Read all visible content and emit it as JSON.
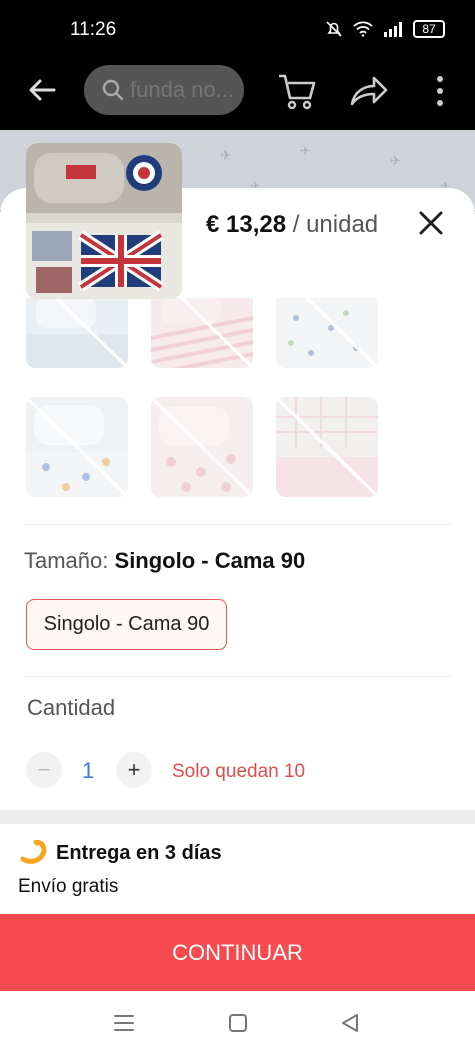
{
  "status_bar": {
    "time": "11:26",
    "battery": "87"
  },
  "toolbar": {
    "search_placeholder": "funda no...",
    "icons": [
      "back-arrow-icon",
      "search-icon",
      "cart-icon",
      "share-icon",
      "more-icon"
    ]
  },
  "sheet": {
    "price_amount": "€ 13,28",
    "price_unit": "/ unidad",
    "size_label_prefix": "Tamaño:",
    "size_selected": "Singolo - Cama 90",
    "size_options": [
      "Singolo - Cama 90"
    ],
    "quantity_label": "Cantidad",
    "quantity_value": "1",
    "decrement_symbol": "−",
    "increment_symbol": "+",
    "stock_note": "Solo quedan 10",
    "delivery_title": "Entrega en 3 días",
    "shipping": "Envío gratis",
    "continue_label": "CONTINUAR"
  },
  "colors": {
    "accent": "#f64a4f",
    "chip_border": "#e35a5a",
    "stock_text": "#e04c4c",
    "qty_value": "#3a7bd5",
    "delivery_icon": "#f5a623"
  }
}
